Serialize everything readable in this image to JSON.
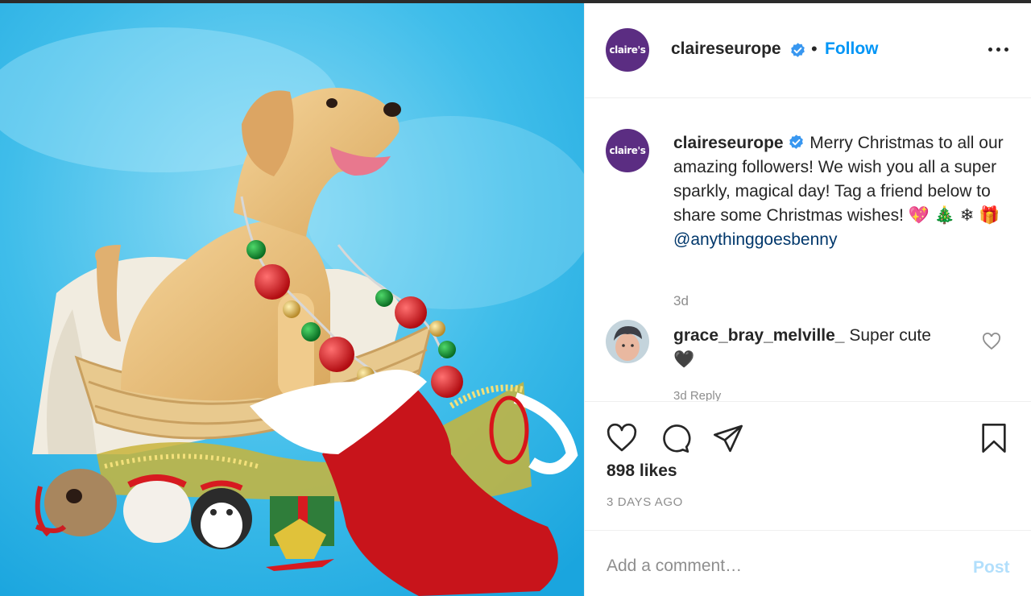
{
  "post": {
    "username": "claireseurope",
    "brand_avatar_text": "claire's",
    "follow_label": "Follow",
    "separator": "•",
    "photo_alt": "Labrador puppy sitting in a wicker basket with Christmas decorations"
  },
  "caption": {
    "text": "Merry Christmas to all our amazing followers! We wish you all a super sparkly, magical day! Tag a friend below to share some Christmas wishes! 💖 🎄 ❄ 🎁",
    "mention": "@anythinggoesbenny",
    "time": "3d"
  },
  "comment": {
    "username": "grace_bray_melville_",
    "text": "Super cute",
    "emoji": "🖤",
    "meta": "3d    Reply"
  },
  "actions": {
    "likes": "898 likes",
    "posted": "3 DAYS AGO"
  },
  "comment_box": {
    "placeholder": "Add a comment…",
    "post_label": "Post"
  },
  "colors": {
    "link": "#0095f6",
    "mention": "#00376b",
    "brand_purple": "#5b2d82",
    "photo_bg": "#2fb6e8"
  },
  "icons": [
    "verified-badge-icon",
    "more-options-icon",
    "heart-icon",
    "comment-icon",
    "share-icon",
    "bookmark-icon"
  ]
}
